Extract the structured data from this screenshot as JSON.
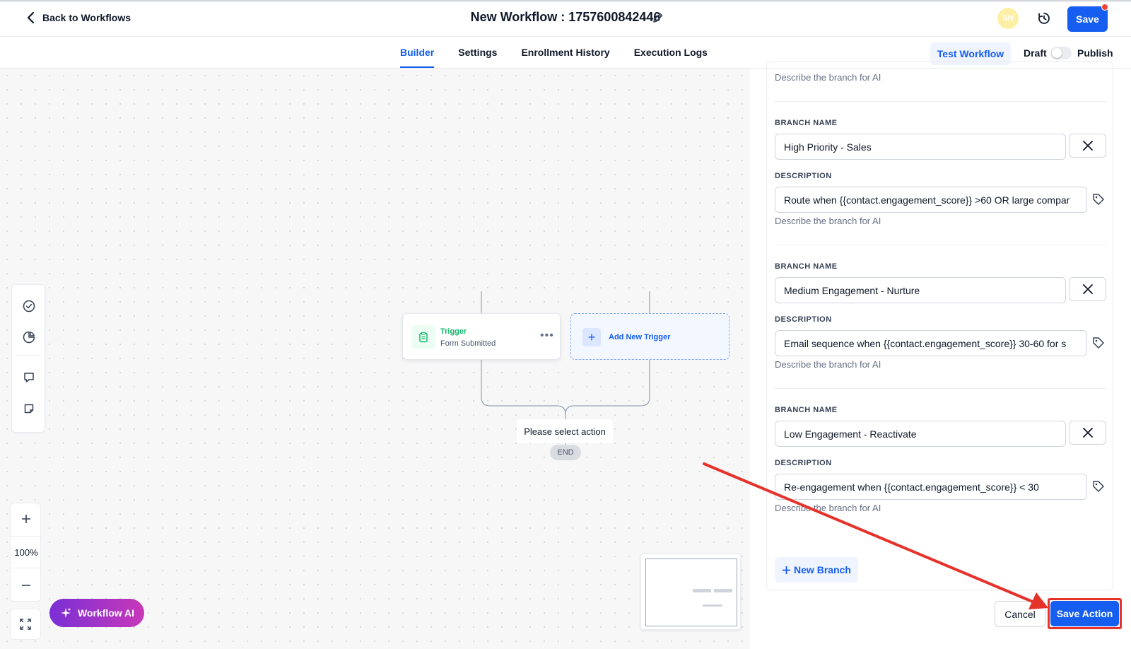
{
  "header": {
    "back_label": "Back to Workflows",
    "title": "New Workflow : 1757600842446",
    "avatar_initials": "SN",
    "save_label": "Save"
  },
  "tabs": [
    {
      "label": "Builder",
      "active": true
    },
    {
      "label": "Settings",
      "active": false
    },
    {
      "label": "Enrollment History",
      "active": false
    },
    {
      "label": "Execution Logs",
      "active": false
    }
  ],
  "toolbar": {
    "test_label": "Test Workflow",
    "draft_label": "Draft",
    "publish_label": "Publish",
    "publish_on": false
  },
  "canvas": {
    "zoom_level": "100%",
    "trigger": {
      "title": "Trigger",
      "subtitle": "Form Submitted"
    },
    "add_trigger_label": "Add New Trigger",
    "select_action_label": "Please select action",
    "end_label": "END",
    "workflow_ai_label": "Workflow AI"
  },
  "panel": {
    "top_helper": "Describe the branch for AI",
    "branch_name_label": "BRANCH NAME",
    "description_label": "DESCRIPTION",
    "helper_text": "Describe the branch for AI",
    "branches": [
      {
        "name": "High Priority - Sales",
        "description": "Route when {{contact.engagement_score}} >60 OR large compar"
      },
      {
        "name": "Medium Engagement - Nurture",
        "description": "Email sequence when  {{contact.engagement_score}} 30-60 for s"
      },
      {
        "name": "Low Engagement - Reactivate",
        "description": "Re-engagement when {{contact.engagement_score}} < 30"
      }
    ],
    "new_branch_label": "New Branch",
    "cancel_label": "Cancel",
    "save_action_label": "Save Action"
  },
  "colors": {
    "primary": "#155eef",
    "annotation_red": "#e5322b",
    "trigger_green": "#12b76a"
  }
}
